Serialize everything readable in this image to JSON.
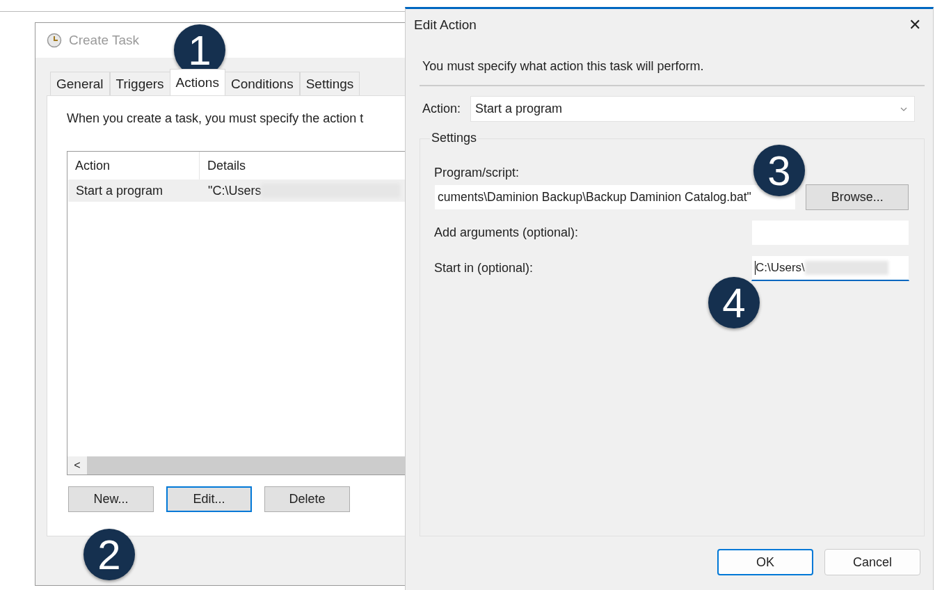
{
  "create_task_window": {
    "title": "Create Task",
    "tabs": [
      {
        "label": "General",
        "selected": false
      },
      {
        "label": "Triggers",
        "selected": false
      },
      {
        "label": "Actions",
        "selected": true
      },
      {
        "label": "Conditions",
        "selected": false
      },
      {
        "label": "Settings",
        "selected": false
      }
    ],
    "description": "When you create a task, you must specify the action t",
    "table": {
      "columns": [
        "Action",
        "Details"
      ],
      "rows": [
        {
          "action": "Start a program",
          "details": "\"C:\\Users",
          "selected": true
        }
      ]
    },
    "scrollbar_left": "<",
    "buttons": [
      {
        "label": "New...",
        "focused": false
      },
      {
        "label": "Edit...",
        "focused": true
      },
      {
        "label": "Delete",
        "focused": false
      }
    ]
  },
  "edit_action_dialog": {
    "title": "Edit Action",
    "close": "✕",
    "instruction": "You must specify what action this task will perform.",
    "action_label": "Action:",
    "action_value": "Start a program",
    "settings_group": "Settings",
    "fields": [
      {
        "label": "Program/script:",
        "value": "cuments\\Daminion Backup\\Backup Daminion Catalog.bat\"",
        "focused": false
      },
      {
        "label": "Add arguments (optional):",
        "focused": false
      },
      {
        "label": "Start in (optional):",
        "value": "C:\\Users\\",
        "focused": true
      }
    ],
    "browse_button": "Browse...",
    "buttons": [
      {
        "label": "OK",
        "focused": true
      },
      {
        "label": "Cancel",
        "focused": false
      }
    ]
  },
  "callouts": [
    "1",
    "2",
    "3",
    "4"
  ]
}
